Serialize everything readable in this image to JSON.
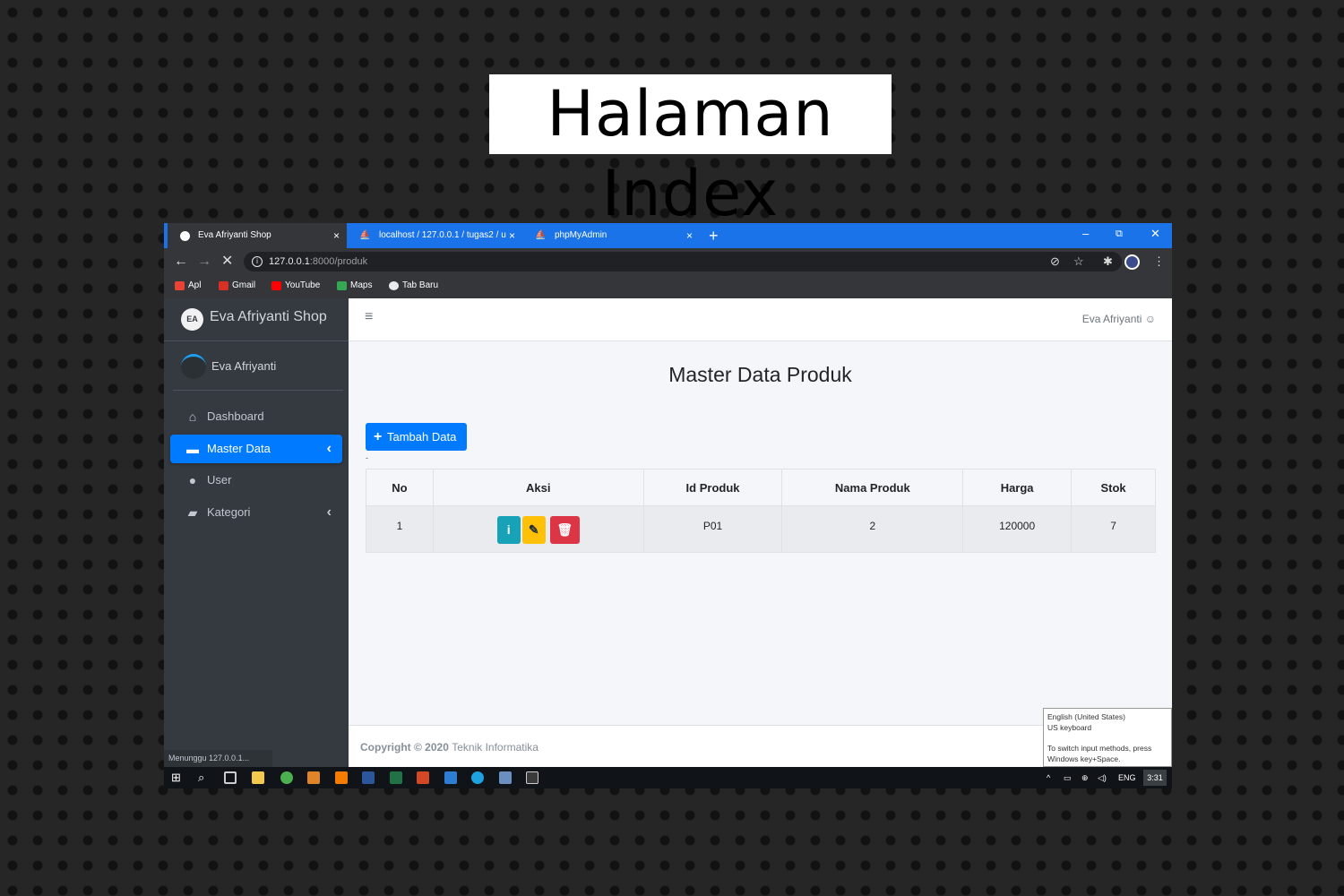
{
  "poster": {
    "title": "Halaman Index"
  },
  "browser": {
    "tabs": [
      {
        "label": "Eva Afriyanti Shop",
        "close": "×"
      },
      {
        "label": "localhost / 127.0.0.1 / tugas2 / u",
        "close": "×"
      },
      {
        "label": "phpMyAdmin",
        "close": "×"
      }
    ],
    "new_tab": "+",
    "window_controls": {
      "minimize": "–",
      "restore": "⧉",
      "close": "✕"
    },
    "nav": {
      "back": "←",
      "forward": "→",
      "stop": "✕"
    },
    "address": {
      "host": "127.0.0.1",
      "path": ":8000/produk"
    },
    "bookmarks": [
      {
        "label": "Apl",
        "color": "#ea4335"
      },
      {
        "label": "Gmail",
        "color": "#d93025"
      },
      {
        "label": "YouTube",
        "color": "#ff0000"
      },
      {
        "label": "Maps",
        "color": "#34a853"
      },
      {
        "label": "Tab Baru",
        "color": "#e8eaed"
      }
    ]
  },
  "sidebar": {
    "brand_logo": "EA",
    "brand": "Eva Afriyanti Shop",
    "user_name": "Eva Afriyanti",
    "items": [
      {
        "label": "Dashboard",
        "icon": "home-icon",
        "glyph": "⌂"
      },
      {
        "label": "Master Data",
        "icon": "database-icon",
        "glyph": "▬",
        "chevron": "‹"
      },
      {
        "label": "User",
        "icon": "user-icon",
        "glyph": "●"
      },
      {
        "label": "Kategori",
        "icon": "folder-icon",
        "glyph": "▰",
        "chevron": "‹"
      }
    ],
    "status": "Menunggu 127.0.0.1..."
  },
  "topnav": {
    "menu_icon": "≡",
    "user": "Eva Afriyanti ☺"
  },
  "main": {
    "title": "Master Data Produk",
    "add_button": "Tambah Data",
    "add_icon": "+",
    "dash": "-",
    "table": {
      "headers": [
        "No",
        "Aksi",
        "Id Produk",
        "Nama Produk",
        "Harga",
        "Stok"
      ],
      "rows": [
        {
          "no": "1",
          "id": "P01",
          "nama": "2",
          "harga": "120000",
          "stok": "7"
        }
      ],
      "actions": {
        "info": "i",
        "edit": "✎",
        "delete": "🗑"
      }
    }
  },
  "footer": {
    "copyright": "Copyright © 2020",
    "org": "Teknik Informatika"
  },
  "ime_popup": {
    "line1": "English (United States)",
    "line2": "US keyboard",
    "line3": "To switch input methods, press",
    "line4": "Windows key+Space."
  },
  "taskbar": {
    "lang": "ENG",
    "time": "3:31",
    "start": "⊞",
    "search": "⌕"
  }
}
